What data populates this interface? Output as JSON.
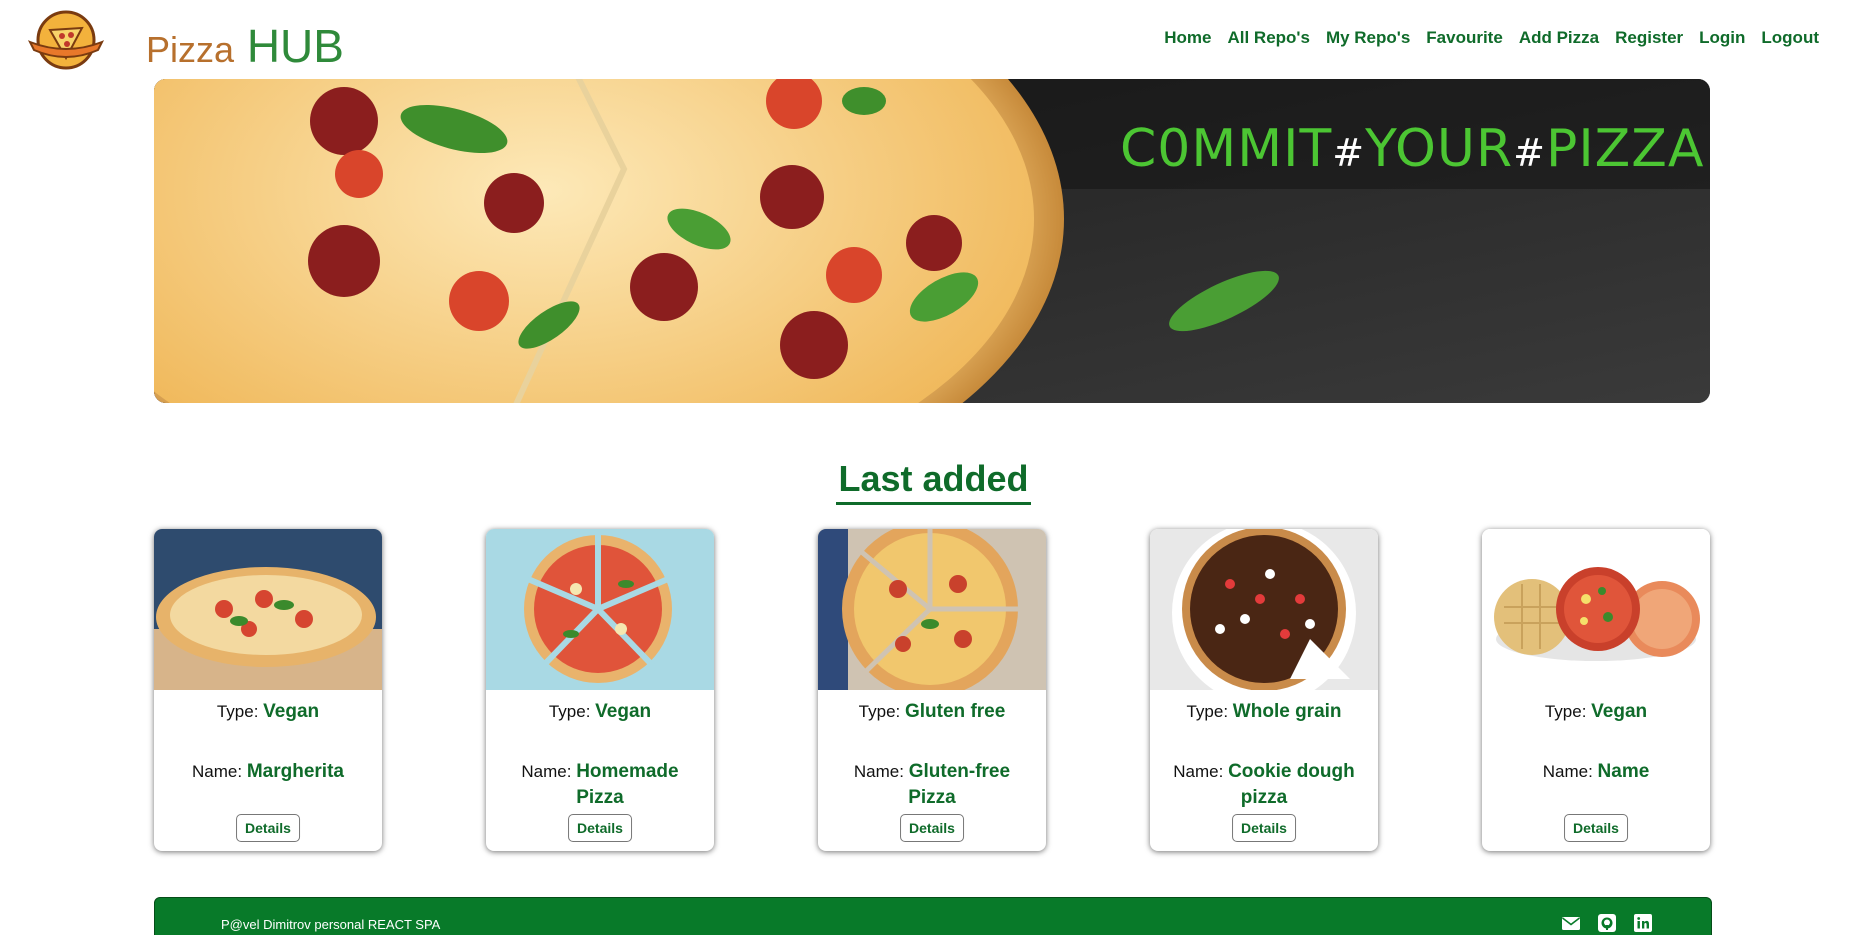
{
  "header": {
    "brand_part1": "Pizza",
    "brand_part2": "HUB",
    "nav": [
      "Home",
      "All Repo's",
      "My Repo's",
      "Favourite",
      "Add Pizza",
      "Register",
      "Login",
      "Logout"
    ]
  },
  "hero": {
    "word1": "C0MMIT",
    "sep1": "#",
    "word2": "YOUR",
    "sep2": "#",
    "word3": "PIZZA"
  },
  "section": {
    "title": "Last added"
  },
  "cards": [
    {
      "type_label": "Type:",
      "type": "Vegan",
      "name_label": "Name:",
      "name": "Margherita",
      "button": "Details"
    },
    {
      "type_label": "Type:",
      "type": "Vegan",
      "name_label": "Name:",
      "name": "Homemade Pizza",
      "button": "Details"
    },
    {
      "type_label": "Type:",
      "type": "Gluten free",
      "name_label": "Name:",
      "name": "Gluten-free Pizza",
      "button": "Details"
    },
    {
      "type_label": "Type:",
      "type": "Whole grain",
      "name_label": "Name:",
      "name": "Cookie dough pizza",
      "button": "Details"
    },
    {
      "type_label": "Type:",
      "type": "Vegan",
      "name_label": "Name:",
      "name": "Name",
      "button": "Details"
    }
  ],
  "footer": {
    "credit": "P@vel Dimitrov personal REACT SPA",
    "icons": [
      "mail-icon",
      "github-icon",
      "linkedin-icon"
    ]
  },
  "colors": {
    "accent_green": "#0f6b2a",
    "footer_green": "#087a29",
    "brand_orange": "#b7702d",
    "hero_green": "#4cc633"
  }
}
